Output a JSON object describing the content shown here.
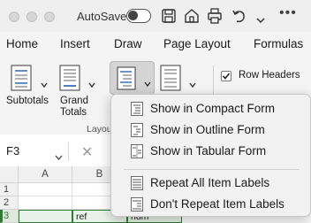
{
  "titlebar": {
    "autosave_label": "AutoSave",
    "autosave_state": "off",
    "icons": [
      "save-icon",
      "home-icon",
      "print-icon",
      "undo-icon",
      "more-icon"
    ]
  },
  "tabs": [
    {
      "label": "Home"
    },
    {
      "label": "Insert"
    },
    {
      "label": "Draw"
    },
    {
      "label": "Page Layout"
    },
    {
      "label": "Formulas"
    }
  ],
  "ribbon": {
    "subtotals_label": "Subtotals",
    "grand_totals_label_line1": "Grand",
    "grand_totals_label_line2": "Totals",
    "group_label": "Layou",
    "row_headers_label": "Row Headers",
    "row_headers_checked": true
  },
  "formula_bar": {
    "name_box": "F3",
    "cancel_symbol": "✕"
  },
  "grid": {
    "columns": [
      "A",
      "B"
    ],
    "rows": [
      "1",
      "2",
      "3"
    ],
    "row3_cells": [
      "",
      "ref",
      "num"
    ]
  },
  "menu": {
    "items": [
      {
        "label": "Show in Compact Form",
        "icon": "compact-form-icon"
      },
      {
        "label": "Show in Outline Form",
        "icon": "outline-form-icon"
      },
      {
        "label": "Show in Tabular Form",
        "icon": "tabular-form-icon"
      },
      {
        "label": "Repeat All Item Labels",
        "icon": "repeat-labels-icon"
      },
      {
        "label": "Don't Repeat Item Labels",
        "icon": "no-repeat-labels-icon"
      }
    ]
  },
  "colors": {
    "accent_green": "#2e7d32",
    "menu_bg": "#f2f2f2"
  }
}
